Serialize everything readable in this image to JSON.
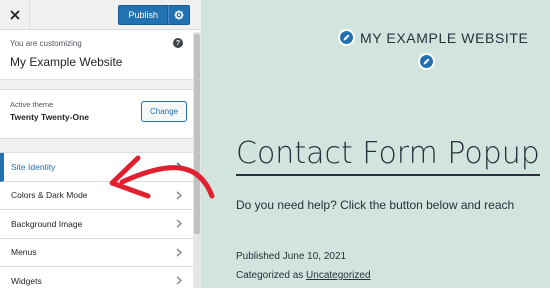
{
  "sidebar": {
    "publish_label": "Publish",
    "customizing_label": "You are customizing",
    "site_title": "My Example Website",
    "active_theme_label": "Active theme",
    "theme_name": "Twenty Twenty-One",
    "change_label": "Change",
    "panels": [
      {
        "label": "Site Identity",
        "active": true
      },
      {
        "label": "Colors & Dark Mode",
        "active": false
      },
      {
        "label": "Background Image",
        "active": false
      },
      {
        "label": "Menus",
        "active": false
      },
      {
        "label": "Widgets",
        "active": false
      }
    ]
  },
  "preview": {
    "site_header": "MY EXAMPLE WEBSITE",
    "post_title": "Contact Form Popup",
    "post_text": "Do you need help? Click the button below and reach",
    "published": "Published June 10, 2021",
    "categorized_prefix": "Categorized as",
    "category": "Uncategorized"
  },
  "colors": {
    "accent": "#2271b1",
    "preview_bg": "#d1e4dd",
    "annotation_arrow": "#e0202f"
  },
  "icons": {
    "close": "close-icon",
    "settings": "gear-icon",
    "help": "help-icon",
    "edit": "pencil-icon",
    "chevron": "chevron-right-icon"
  }
}
